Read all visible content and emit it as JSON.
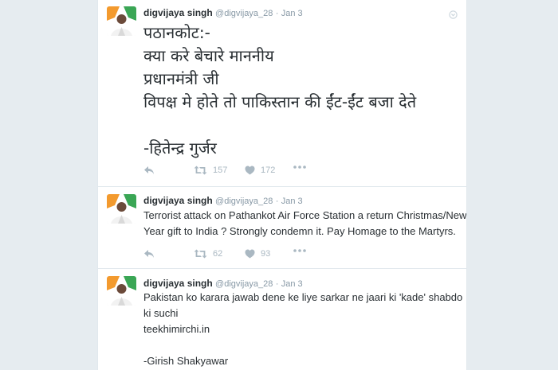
{
  "tweets": [
    {
      "name": "digvijaya singh",
      "handle": "@digvijaya_28",
      "date": "Jan 3",
      "lines": [
        "पठानकोट:-",
        "क्या करे बेचारे माननीय",
        "प्रधानमंत्री जी",
        "विपक्ष मे होते तो पाकिस्तान की ईंट-ईंट बजा देते",
        "",
        "-हितेन्द्र गुर्जर"
      ],
      "retweets": "157",
      "likes": "172"
    },
    {
      "name": "digvijaya singh",
      "handle": "@digvijaya_28",
      "date": "Jan 3",
      "lines": [
        "Terrorist attack on Pathankot Air Force Station a return Christmas/New",
        "Year gift to India ? Strongly condemn it. Pay Homage to the Martyrs."
      ],
      "retweets": "62",
      "likes": "93"
    },
    {
      "name": "digvijaya singh",
      "handle": "@digvijaya_28",
      "date": "Jan 3",
      "lines": [
        "Pakistan ko karara jawab dene ke liye sarkar ne jaari ki 'kade' shabdo",
        "ki suchi",
        "teekhimirchi.in",
        "",
        "-Girish Shakyawar"
      ],
      "retweets": "",
      "likes": ""
    }
  ],
  "icons": {
    "reply": "reply-icon",
    "retweet": "retweet-icon",
    "like": "heart-icon",
    "more": "more-icon",
    "caret": "caret-icon"
  },
  "colors": {
    "text": "#292f33",
    "meta": "#8899a6",
    "icon": "#aab8c2",
    "background": "#e6ecf0",
    "avatar_accent": "#f39a2e"
  }
}
